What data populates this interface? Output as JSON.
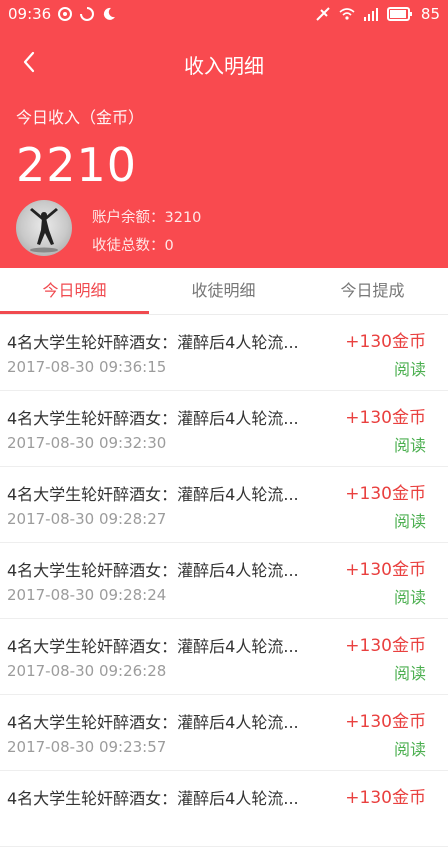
{
  "status_bar": {
    "time": "09:36",
    "battery": "85"
  },
  "header": {
    "title": "收入明细",
    "income_label": "今日收入（金币）",
    "income_value": "2210",
    "balance_text": "账户余额：3210",
    "apprentices_text": "收徒总数：0"
  },
  "tabs": [
    {
      "label": "今日明细"
    },
    {
      "label": "收徒明细"
    },
    {
      "label": "今日提成"
    }
  ],
  "list": [
    {
      "title": "4名大学生轮奸醉酒女：灌醉后4人轮流...",
      "time": "2017-08-30 09:36:15",
      "amount": "+130金币",
      "action": "阅读"
    },
    {
      "title": "4名大学生轮奸醉酒女：灌醉后4人轮流...",
      "time": "2017-08-30 09:32:30",
      "amount": "+130金币",
      "action": "阅读"
    },
    {
      "title": "4名大学生轮奸醉酒女：灌醉后4人轮流...",
      "time": "2017-08-30 09:28:27",
      "amount": "+130金币",
      "action": "阅读"
    },
    {
      "title": "4名大学生轮奸醉酒女：灌醉后4人轮流...",
      "time": "2017-08-30 09:28:24",
      "amount": "+130金币",
      "action": "阅读"
    },
    {
      "title": "4名大学生轮奸醉酒女：灌醉后4人轮流...",
      "time": "2017-08-30 09:26:28",
      "amount": "+130金币",
      "action": "阅读"
    },
    {
      "title": "4名大学生轮奸醉酒女：灌醉后4人轮流...",
      "time": "2017-08-30 09:23:57",
      "amount": "+130金币",
      "action": "阅读"
    },
    {
      "title": "4名大学生轮奸醉酒女：灌醉后4人轮流...",
      "time": "",
      "amount": "+130金币",
      "action": ""
    }
  ],
  "colors": {
    "brand_red": "#f94a4f",
    "amount_red": "#e9403f",
    "read_green": "#4caf50"
  }
}
